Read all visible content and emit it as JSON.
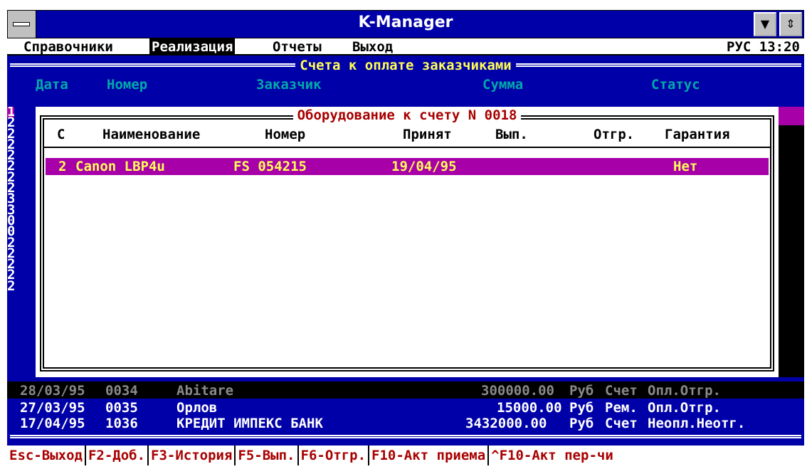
{
  "window": {
    "title": "K-Manager"
  },
  "menu": {
    "items": [
      "Справочники",
      "Реализация",
      "Отчеты",
      "Выход"
    ],
    "status": "РУС 13:20"
  },
  "list_window": {
    "title": "Счета к оплате заказчиками",
    "columns": [
      "Дата",
      "Номер",
      "Заказчик",
      "Сумма",
      "Статус"
    ],
    "left_digits": [
      "1",
      "2",
      "2",
      "2",
      "2",
      "2",
      "2",
      "2",
      "3",
      "3",
      "0",
      "0",
      "2",
      "2",
      "2",
      "2",
      "2"
    ],
    "rows": [
      {
        "date": "28/03/95",
        "number": "0034",
        "customer": "Abitare",
        "amount": "300000.00",
        "currency": "Руб",
        "doc": "Счет",
        "status": "Опл.Отгр."
      },
      {
        "date": "27/03/95",
        "number": "0035",
        "customer": "Орлов",
        "amount": "15000.00",
        "currency": "Руб",
        "doc": "Рем.",
        "status": "Опл.Отгр."
      },
      {
        "date": "17/04/95",
        "number": "1036",
        "customer": "КРЕДИТ ИМПЕКС БАНК",
        "amount": "3432000.00",
        "currency": "Руб",
        "doc": "Счет",
        "status": "Неопл.Неотг."
      }
    ]
  },
  "popup": {
    "title": "Оборудование к счету N 0018",
    "columns": [
      "С",
      "Наименование",
      "Номер",
      "Принят",
      "Вып.",
      "Отгр.",
      "Гарантия"
    ],
    "selected_row": {
      "c": "2",
      "name": "Canon LBP4u",
      "number": "FS 054215",
      "accepted": "19/04/95",
      "done": "",
      "shipped": "",
      "warranty": "Нет"
    }
  },
  "function_keys": [
    "Esc-Выход",
    "F2-Доб.",
    "F3-История",
    "F5-Вып.",
    "F6-Отгр.",
    "F10-Акт приема",
    "^F10-Акт пер-чи"
  ],
  "colors": {
    "background": "#0000a8",
    "highlight": "#a800a8",
    "accent_text": "#ffff55",
    "header_text": "#00aaaa"
  }
}
